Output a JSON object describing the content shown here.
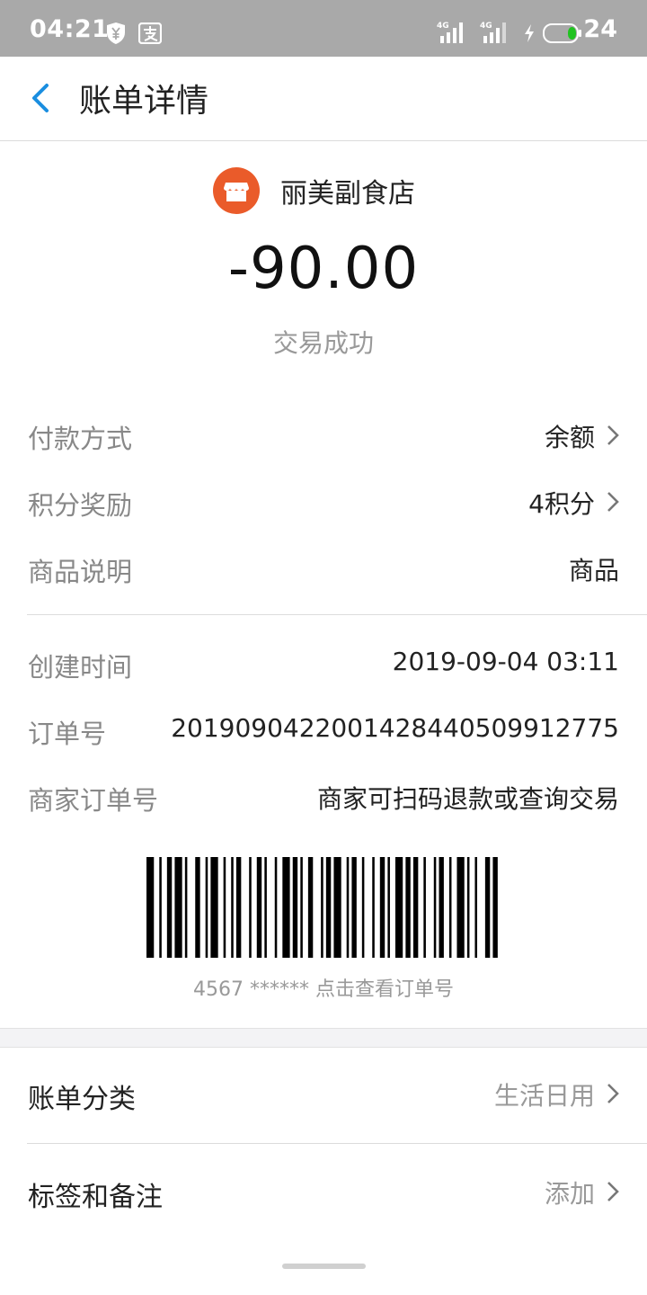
{
  "status_bar": {
    "time": "04:21",
    "battery": "24",
    "icons": [
      "shield-yen-icon",
      "alipay-icon",
      "signal-4g-icon",
      "signal-4g-icon",
      "charging-icon",
      "battery-icon"
    ]
  },
  "header": {
    "title": "账单详情",
    "back_icon": "chevron-left-icon"
  },
  "merchant": {
    "name": "丽美副食店",
    "logo_icon": "store-icon",
    "logo_color": "#ea5b2a"
  },
  "transaction": {
    "amount": "-90.00",
    "status": "交易成功"
  },
  "details": [
    {
      "label": "付款方式",
      "value": "余额",
      "has_chevron": true
    },
    {
      "label": "积分奖励",
      "value": "4积分",
      "has_chevron": true
    },
    {
      "label": "商品说明",
      "value": "商品",
      "has_chevron": false
    }
  ],
  "order_info": [
    {
      "label": "创建时间",
      "value": "2019-09-04 03:11"
    },
    {
      "label": "订单号",
      "value": "2019090422001428440509912775"
    },
    {
      "label": "商家订单号",
      "value": "商家可扫码退款或查询交易"
    }
  ],
  "barcode": {
    "caption": "4567 ****** 点击查看订单号"
  },
  "extra": [
    {
      "label": "账单分类",
      "value": "生活日用"
    },
    {
      "label": "标签和备注",
      "value": "添加"
    }
  ],
  "colors": {
    "accent_blue": "#1a8ee0",
    "status_bar": "#a9a9a9",
    "battery_green": "#21c321"
  }
}
